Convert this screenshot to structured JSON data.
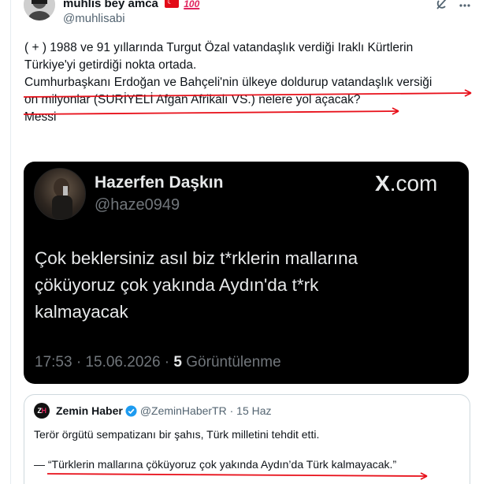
{
  "author": {
    "display_name": "muhlis bey amca",
    "handle": "@muhlisabi",
    "badge_text": "100"
  },
  "tweet": {
    "lines": [
      "( + ) 1988 ve 91 yıllarında Turgut Özal vatandaşlık verdiği Iraklı Kürtlerin",
      "Türkiye'yi getirdiği nokta ortada.",
      "Cumhurbaşkanı Erdoğan ve Bahçeli'nin ülkeye doldurup vatandaşlık versiği",
      "on milyonlar (SURİYELİ Afgan Afrikalı  VS.) nelere yol açacak?",
      "Messi"
    ]
  },
  "embedded_post": {
    "name": "Hazerfen Daşkın",
    "handle": "@haze0949",
    "brand": "X",
    "brand_suffix": ".com",
    "body_lines": [
      "Çok beklersiniz asıl biz t*rklerin mallarına",
      "çöküyoruz çok yakında Aydın'da t*rk",
      "kalmayacak"
    ],
    "time": "17:53 · 15.06.2026 · ",
    "views_count": "5",
    "views_label": " Görüntülenme"
  },
  "quote": {
    "avatar_text_z": "Z",
    "avatar_text_h": "H",
    "name": "Zemin Haber",
    "handle": "@ZeminHaberTR",
    "separator": " · ",
    "date": "15 Haz",
    "text1": "Terör örgütü sempatizanı bir şahıs, Türk milletini tehdit etti.",
    "text2": "— “Türklerin mallarına çöküyoruz çok yakında Aydın’da Türk kalmayacak.”"
  },
  "icons": {
    "grok": "grok-icon",
    "more": "more-icon",
    "verified": "verified-badge-icon",
    "flag": "turkey-flag-icon"
  },
  "colors": {
    "annotation_red": "#e8101a",
    "verified_blue": "#1d9bf0",
    "muted_text": "#536471"
  }
}
